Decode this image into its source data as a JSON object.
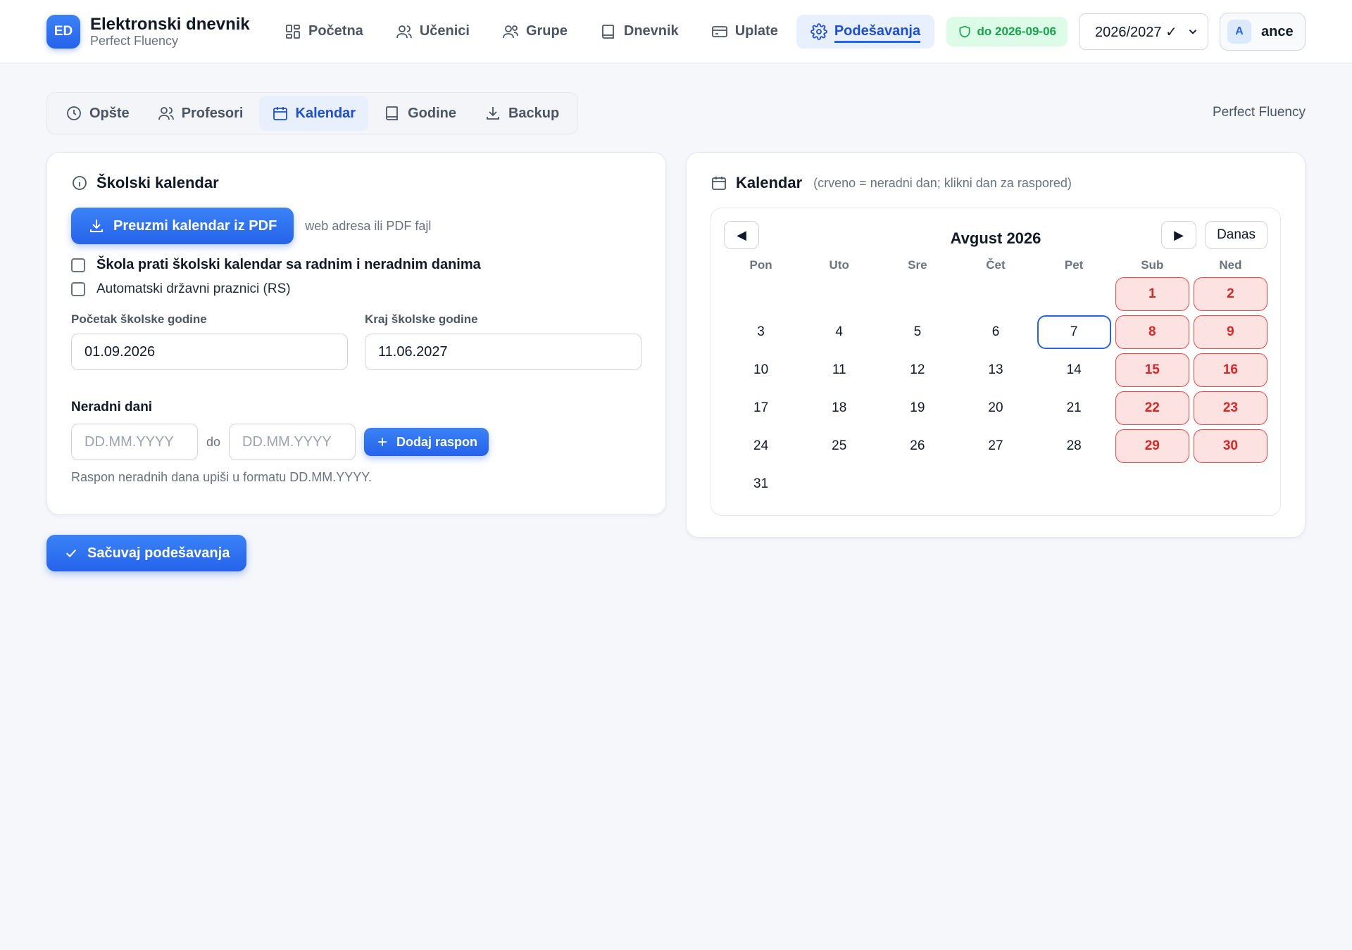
{
  "app": {
    "logo_text": "ED",
    "title": "Elektronski dnevnik",
    "subtitle": "Perfect Fluency"
  },
  "nav": [
    {
      "label": "Početna",
      "icon": "dashboard-icon",
      "active": false
    },
    {
      "label": "Učenici",
      "icon": "users-icon",
      "active": false
    },
    {
      "label": "Grupe",
      "icon": "group-icon",
      "active": false
    },
    {
      "label": "Dnevnik",
      "icon": "book-icon",
      "active": false
    },
    {
      "label": "Uplate",
      "icon": "card-icon",
      "active": false
    },
    {
      "label": "Podešavanja",
      "icon": "gear-icon",
      "active": true
    }
  ],
  "header": {
    "license_badge": "do 2026-09-06",
    "school_year": "2026/2027 ✓",
    "user_initial": "A",
    "user_name": "ance"
  },
  "subtabs": [
    {
      "label": "Opšte",
      "icon": "clock-icon",
      "active": false
    },
    {
      "label": "Profesori",
      "icon": "users-icon",
      "active": false
    },
    {
      "label": "Kalendar",
      "icon": "calendar-icon",
      "active": true
    },
    {
      "label": "Godine",
      "icon": "book-icon",
      "active": false
    },
    {
      "label": "Backup",
      "icon": "download-icon",
      "active": false
    }
  ],
  "school_name": "Perfect Fluency",
  "school_calendar": {
    "title": "Školski kalendar",
    "pdf_button": "Preuzmi kalendar iz PDF",
    "pdf_hint": "web adresa ili PDF fajl",
    "check_follow_calendar": "Škola prati školski kalendar sa radnim i neradnim danima",
    "check_holidays": "Automatski državni praznici (RS)",
    "start_label": "Početak školske godine",
    "start_value": "01.09.2026",
    "end_label": "Kraj školske godine",
    "end_value": "11.06.2027",
    "non_working_label": "Neradni dani",
    "range_from_placeholder": "DD.MM.YYYY",
    "range_sep": "do",
    "range_to_placeholder": "DD.MM.YYYY",
    "add_range_button": "Dodaj raspon",
    "range_hint": "Raspon neradnih dana upiši u formatu DD.MM.YYYY."
  },
  "save_button": "Sačuvaj podešavanja",
  "calendar": {
    "title": "Kalendar",
    "hint": "(crveno = neradni dan; klikni dan za raspored)",
    "prev": "◀",
    "next": "▶",
    "today_button": "Danas",
    "month_label": "Avgust 2026",
    "weekdays": [
      "Pon",
      "Uto",
      "Sre",
      "Čet",
      "Pet",
      "Sub",
      "Ned"
    ],
    "leading_blanks": 5,
    "days_in_month": 31,
    "today": 7,
    "non_working_days": [
      1,
      2,
      8,
      9,
      15,
      16,
      22,
      23,
      29,
      30
    ]
  },
  "colors": {
    "accent": "#2563eb",
    "non_working_bg": "#fde2e2",
    "non_working_text": "#dc2626",
    "badge_green": "#16a34a"
  }
}
